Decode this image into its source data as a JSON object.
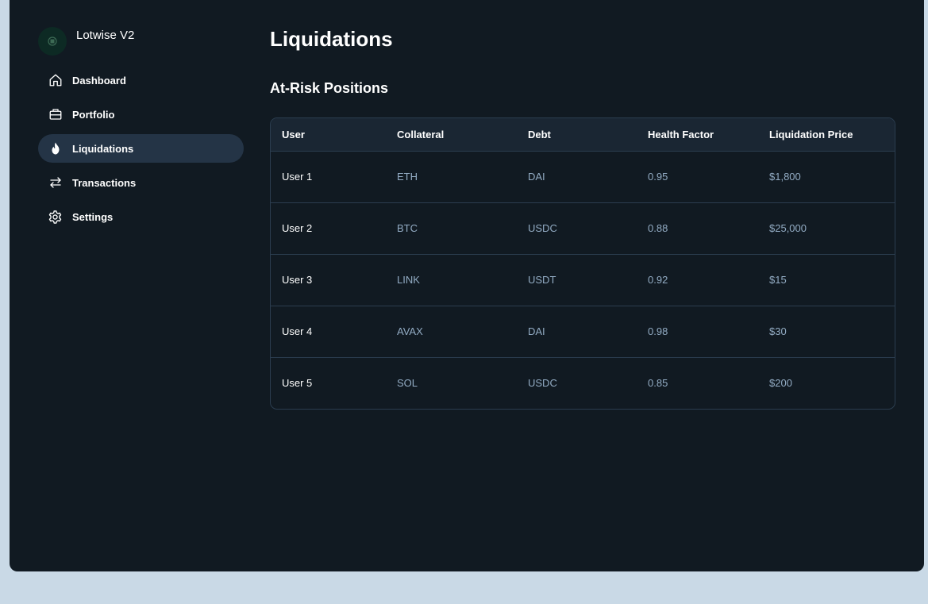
{
  "app": {
    "name": "Lotwise V2"
  },
  "sidebar": {
    "items": [
      {
        "label": "Dashboard",
        "icon": "home-icon",
        "active": false
      },
      {
        "label": "Portfolio",
        "icon": "briefcase-icon",
        "active": false
      },
      {
        "label": "Liquidations",
        "icon": "flame-icon",
        "active": true
      },
      {
        "label": "Transactions",
        "icon": "arrows-swap-icon",
        "active": false
      },
      {
        "label": "Settings",
        "icon": "gear-icon",
        "active": false
      }
    ]
  },
  "main": {
    "title": "Liquidations",
    "section_title": "At-Risk Positions",
    "table": {
      "columns": [
        "User",
        "Collateral",
        "Debt",
        "Health Factor",
        "Liquidation Price"
      ],
      "rows": [
        [
          "User 1",
          "ETH",
          "DAI",
          "0.95",
          "$1,800"
        ],
        [
          "User 2",
          "BTC",
          "USDC",
          "0.88",
          "$25,000"
        ],
        [
          "User 3",
          "LINK",
          "USDT",
          "0.92",
          "$15"
        ],
        [
          "User 4",
          "AVAX",
          "DAI",
          "0.98",
          "$30"
        ],
        [
          "User 5",
          "SOL",
          "USDC",
          "0.85",
          "$200"
        ]
      ]
    }
  },
  "colors": {
    "background": "#c9d9e6",
    "panel": "#111a22",
    "active_nav": "#243446",
    "table_header": "#1a2633",
    "border": "#2b3d4f",
    "muted_text": "#93acc4"
  }
}
